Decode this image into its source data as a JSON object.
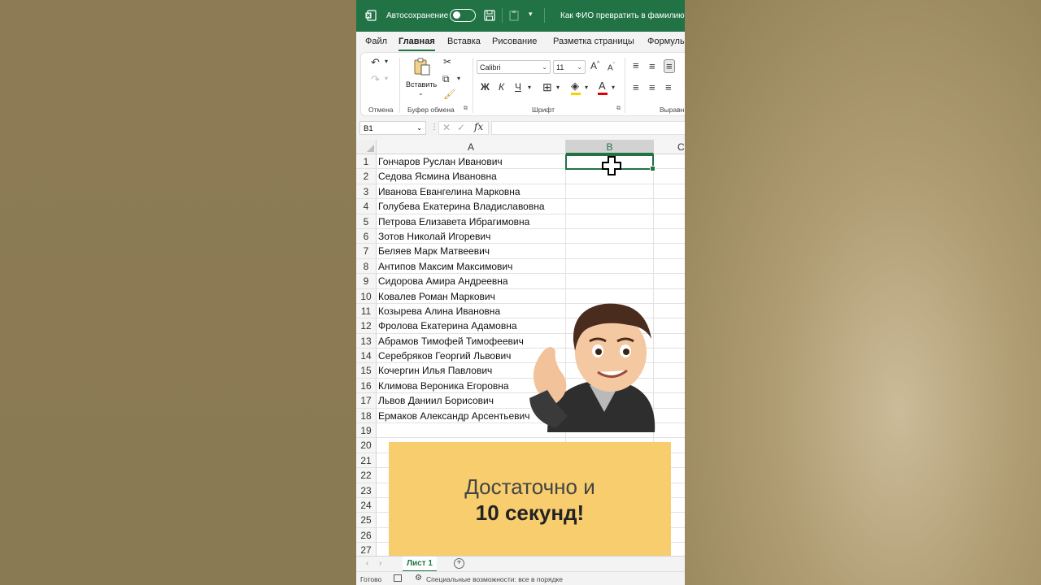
{
  "titlebar": {
    "autosave_label": "Автосохранение",
    "document_title": "Как ФИО превратить в фамилию и"
  },
  "tabs": [
    "Файл",
    "Главная",
    "Вставка",
    "Рисование",
    "Разметка страницы",
    "Формулы"
  ],
  "ribbon": {
    "paste_label": "Вставить",
    "group_undo": "Отмена",
    "group_clipboard": "Буфер обмена",
    "group_font": "Шрифт",
    "group_align": "Выравн",
    "font_name": "Calibri",
    "font_size": "11",
    "bold": "Ж",
    "italic": "К",
    "underline": "Ч"
  },
  "formula_bar": {
    "name_box": "B1",
    "fx": "fx",
    "formula": ""
  },
  "columns": [
    "A",
    "B",
    "C"
  ],
  "rows": [
    {
      "n": "1",
      "a": "Гончаров Руслан Иванович"
    },
    {
      "n": "2",
      "a": "Седова Ясмина Ивановна"
    },
    {
      "n": "3",
      "a": "Иванова Евангелина Марковна"
    },
    {
      "n": "4",
      "a": "Голубева Екатерина Владиславовна"
    },
    {
      "n": "5",
      "a": "Петрова Елизавета Ибрагимовна"
    },
    {
      "n": "6",
      "a": "Зотов Николай Игоревич"
    },
    {
      "n": "7",
      "a": "Беляев Марк Матвеевич"
    },
    {
      "n": "8",
      "a": "Антипов Максим Максимович"
    },
    {
      "n": "9",
      "a": "Сидорова Амира Андреевна"
    },
    {
      "n": "10",
      "a": "Ковалев Роман Маркович"
    },
    {
      "n": "11",
      "a": "Козырева Алина Ивановна"
    },
    {
      "n": "12",
      "a": "Фролова Екатерина Адамовна"
    },
    {
      "n": "13",
      "a": "Абрамов Тимофей Тимофеевич"
    },
    {
      "n": "14",
      "a": "Серебряков Георгий Львович"
    },
    {
      "n": "15",
      "a": "Кочергин Илья Павлович"
    },
    {
      "n": "16",
      "a": "Климова Вероника Егоровна"
    },
    {
      "n": "17",
      "a": "Львов Даниил Борисович"
    },
    {
      "n": "18",
      "a": "Ермаков Александр Арсентьевич"
    },
    {
      "n": "19",
      "a": ""
    },
    {
      "n": "20",
      "a": ""
    },
    {
      "n": "21",
      "a": ""
    },
    {
      "n": "22",
      "a": ""
    },
    {
      "n": "23",
      "a": ""
    },
    {
      "n": "24",
      "a": ""
    },
    {
      "n": "25",
      "a": ""
    },
    {
      "n": "26",
      "a": ""
    },
    {
      "n": "27",
      "a": ""
    }
  ],
  "banner": {
    "line1": "Достаточно и",
    "line2": "10 секунд!"
  },
  "sheets": {
    "active": "Лист 1"
  },
  "status": {
    "ready": "Готово",
    "accessibility": "Специальные возможности: все в порядке"
  },
  "colors": {
    "excel_green": "#217346",
    "banner_yellow": "#f7cd6e"
  }
}
